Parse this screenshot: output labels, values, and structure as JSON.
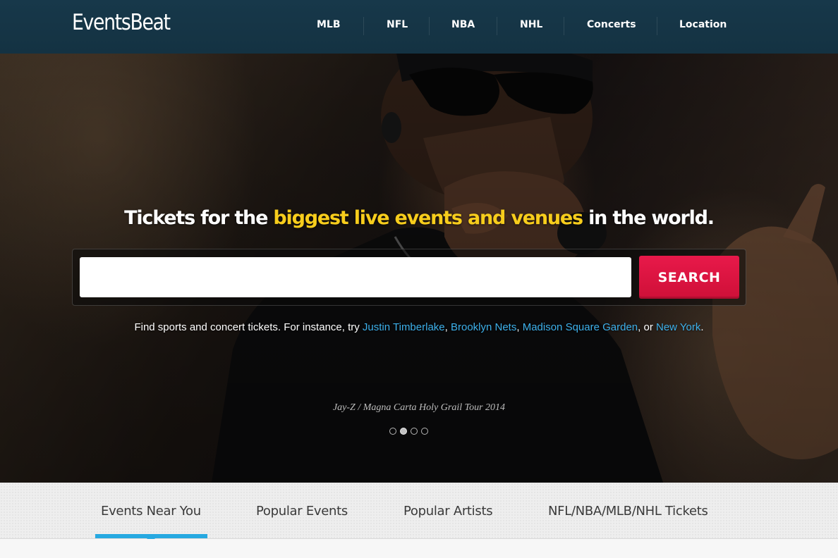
{
  "brand": {
    "logo_text": "EventsBeat"
  },
  "nav": {
    "items": [
      {
        "label": "MLB"
      },
      {
        "label": "NFL"
      },
      {
        "label": "NBA"
      },
      {
        "label": "NHL"
      },
      {
        "label": "Concerts"
      },
      {
        "label": "Location"
      }
    ]
  },
  "hero": {
    "headline": {
      "part1": "Tickets for the ",
      "highlight": "biggest live events and venues",
      "part2": " in the world."
    },
    "search": {
      "input_value": "",
      "placeholder": "",
      "button_label": "SEARCH"
    },
    "hint": {
      "prefix": "Find sports and concert tickets. For instance, try ",
      "links": [
        "Justin Timberlake",
        "Brooklyn Nets",
        "Madison Square Garden",
        "New York"
      ],
      "sep1": ", ",
      "sep2": ", ",
      "sep3": ", or ",
      "suffix": "."
    },
    "caption": "Jay-Z / Magna Carta Holy Grail Tour 2014",
    "carousel": {
      "slide_count": 4,
      "active_index": 1
    }
  },
  "tabs": {
    "items": [
      {
        "label": "Events Near You"
      },
      {
        "label": "Popular Events"
      },
      {
        "label": "Popular Artists"
      },
      {
        "label": "NFL/NBA/MLB/NHL Tickets"
      }
    ],
    "active_index": 0
  },
  "colors": {
    "header_bg": "#17384a",
    "headline_highlight": "#f7cd1c",
    "link": "#3db0ea",
    "search_button": "#e8194a",
    "tab_underline": "#27a9e1"
  }
}
